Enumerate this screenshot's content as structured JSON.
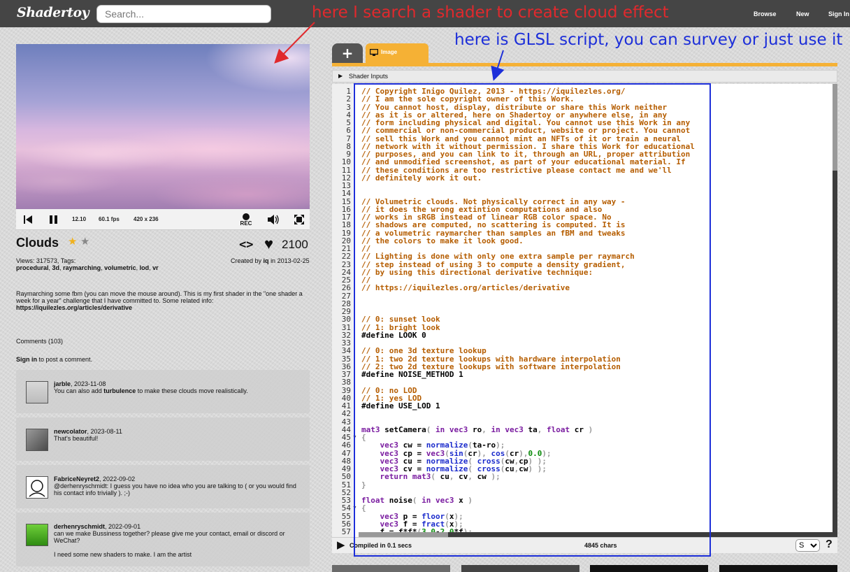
{
  "app": {
    "logo": "Shadertoy"
  },
  "search": {
    "placeholder": "Search..."
  },
  "nav": {
    "browse": "Browse",
    "new": "New",
    "signin": "Sign In"
  },
  "annotations": {
    "search_note": "here I search a shader to create cloud effect",
    "script_note": "here is GLSL script, you can survey or just use it"
  },
  "player": {
    "time": "12.10",
    "fps": "60.1 fps",
    "resolution": "420 x 236",
    "rec_label": "REC"
  },
  "shader": {
    "title": "Clouds",
    "likes": "2100",
    "views_line": "Views: 317573, Tags:",
    "tags": [
      "procedural",
      "3d",
      "raymarching",
      "volumetric",
      "lod",
      "vr"
    ],
    "created_by_prefix": "Created by",
    "author": "iq",
    "created_in": "in 2013-02-25",
    "description": "Raymarching some fbm (you can move the mouse around). This is my first shader in the \"one shader a week for a year\" challenge that I have committed to. Some related info:",
    "description_link": "https://iquilezles.org/articles/derivative"
  },
  "comments": {
    "header": "Comments (103)",
    "signin_link": "Sign in",
    "signin_rest": " to post a comment.",
    "items": [
      {
        "user": "jarble",
        "date": ", 2023-11-08",
        "text": "You can also add ",
        "bold": "turbulence",
        "text_after": " to make these clouds move realistically."
      },
      {
        "user": "newcolator",
        "date": ", 2023-08-11",
        "text": "That's beautiful!"
      },
      {
        "user": "FabriceNeyret2",
        "date": ", 2022-09-02",
        "text": "@derhenryschmidt: I guess you have no idea who you are talking to ( or you would find his contact info trivially ). ;-)"
      },
      {
        "user": "derhenryschmidt",
        "date": ", 2022-09-01",
        "text": "can we make Bussiness together? please give me your contact, email or discord or WeChat?",
        "text2": "I need some new shaders to make. I am the artist"
      }
    ]
  },
  "editor": {
    "tab_label": "Image",
    "add_tab": "+",
    "shader_inputs": "Shader Inputs",
    "status": "Compiled in 0.1 secs",
    "chars": "4845 chars",
    "font_select": "S",
    "help": "?",
    "lines": [
      [
        [
          "c",
          "// Copyright Inigo Quilez, 2013 - https://iquilezles.org/"
        ]
      ],
      [
        [
          "c",
          "// I am the sole copyright owner of this Work."
        ]
      ],
      [
        [
          "c",
          "// You cannot host, display, distribute or share this Work neither"
        ]
      ],
      [
        [
          "c",
          "// as it is or altered, here on Shadertoy or anywhere else, in any"
        ]
      ],
      [
        [
          "c",
          "// form including physical and digital. You cannot use this Work in any"
        ]
      ],
      [
        [
          "c",
          "// commercial or non-commercial product, website or project. You cannot"
        ]
      ],
      [
        [
          "c",
          "// sell this Work and you cannot mint an NFTs of it or train a neural"
        ]
      ],
      [
        [
          "c",
          "// network with it without permission. I share this Work for educational"
        ]
      ],
      [
        [
          "c",
          "// purposes, and you can link to it, through an URL, proper attribution"
        ]
      ],
      [
        [
          "c",
          "// and unmodified screenshot, as part of your educational material. If"
        ]
      ],
      [
        [
          "c",
          "// these conditions are too restrictive please contact me and we'll"
        ]
      ],
      [
        [
          "c",
          "// definitely work it out."
        ]
      ],
      [],
      [],
      [
        [
          "c",
          "// Volumetric clouds. Not physically correct in any way -"
        ]
      ],
      [
        [
          "c",
          "// it does the wrong extintion computations and also"
        ]
      ],
      [
        [
          "c",
          "// works in sRGB instead of linear RGB color space. No"
        ]
      ],
      [
        [
          "c",
          "// shadows are computed, no scattering is computed. It is"
        ]
      ],
      [
        [
          "c",
          "// a volumetric raymarcher than samples an fBM and tweaks"
        ]
      ],
      [
        [
          "c",
          "// the colors to make it look good."
        ]
      ],
      [
        [
          "c",
          "//"
        ]
      ],
      [
        [
          "c",
          "// Lighting is done with only one extra sample per raymarch"
        ]
      ],
      [
        [
          "c",
          "// step instead of using 3 to compute a density gradient,"
        ]
      ],
      [
        [
          "c",
          "// by using this directional derivative technique:"
        ]
      ],
      [
        [
          "c",
          "//"
        ]
      ],
      [
        [
          "c",
          "// https://iquilezles.org/articles/derivative"
        ]
      ],
      [],
      [],
      [],
      [
        [
          "c",
          "// 0: sunset look"
        ]
      ],
      [
        [
          "c",
          "// 1: bright look"
        ]
      ],
      [
        [
          "t",
          "#define LOOK 0"
        ]
      ],
      [],
      [
        [
          "c",
          "// 0: one 3d texture lookup"
        ]
      ],
      [
        [
          "c",
          "// 1: two 2d texture lookups with hardware interpolation"
        ]
      ],
      [
        [
          "c",
          "// 2: two 2d texture lookups with software interpolation"
        ]
      ],
      [
        [
          "t",
          "#define NOISE_METHOD 1"
        ]
      ],
      [],
      [
        [
          "c",
          "// 0: no LOD"
        ]
      ],
      [
        [
          "c",
          "// 1: yes LOD"
        ]
      ],
      [
        [
          "t",
          "#define USE_LOD 1"
        ]
      ],
      [],
      [],
      [
        [
          "k",
          "mat3"
        ],
        [
          "t",
          " setCamera"
        ],
        [
          "p",
          "( "
        ],
        [
          "k",
          "in vec3"
        ],
        [
          "t",
          " ro"
        ],
        [
          "p",
          ", "
        ],
        [
          "k",
          "in vec3"
        ],
        [
          "t",
          " ta"
        ],
        [
          "p",
          ", "
        ],
        [
          "k",
          "float"
        ],
        [
          "t",
          " cr "
        ],
        [
          "p",
          ")"
        ]
      ],
      [
        [
          "p",
          "{"
        ]
      ],
      [
        [
          "t",
          "    "
        ],
        [
          "k",
          "vec3"
        ],
        [
          "t",
          " cw = "
        ],
        [
          "f",
          "normalize"
        ],
        [
          "p",
          "("
        ],
        [
          "t",
          "ta-ro"
        ],
        [
          "p",
          ");"
        ]
      ],
      [
        [
          "t",
          "    "
        ],
        [
          "k",
          "vec3"
        ],
        [
          "t",
          " cp = "
        ],
        [
          "k",
          "vec3"
        ],
        [
          "p",
          "("
        ],
        [
          "f",
          "sin"
        ],
        [
          "p",
          "("
        ],
        [
          "t",
          "cr"
        ],
        [
          "p",
          "), "
        ],
        [
          "f",
          "cos"
        ],
        [
          "p",
          "("
        ],
        [
          "t",
          "cr"
        ],
        [
          "p",
          "),"
        ],
        [
          "n",
          "0.0"
        ],
        [
          "p",
          ");"
        ]
      ],
      [
        [
          "t",
          "    "
        ],
        [
          "k",
          "vec3"
        ],
        [
          "t",
          " cu = "
        ],
        [
          "f",
          "normalize"
        ],
        [
          "p",
          "( "
        ],
        [
          "f",
          "cross"
        ],
        [
          "p",
          "("
        ],
        [
          "t",
          "cw"
        ],
        [
          "p",
          ","
        ],
        [
          "t",
          "cp"
        ],
        [
          "p",
          ") );"
        ]
      ],
      [
        [
          "t",
          "    "
        ],
        [
          "k",
          "vec3"
        ],
        [
          "t",
          " cv = "
        ],
        [
          "f",
          "normalize"
        ],
        [
          "p",
          "( "
        ],
        [
          "f",
          "cross"
        ],
        [
          "p",
          "("
        ],
        [
          "t",
          "cu"
        ],
        [
          "p",
          ","
        ],
        [
          "t",
          "cw"
        ],
        [
          "p",
          ") );"
        ]
      ],
      [
        [
          "t",
          "    "
        ],
        [
          "k",
          "return"
        ],
        [
          "t",
          " "
        ],
        [
          "k",
          "mat3"
        ],
        [
          "p",
          "( "
        ],
        [
          "t",
          "cu"
        ],
        [
          "p",
          ", "
        ],
        [
          "t",
          "cv"
        ],
        [
          "p",
          ", "
        ],
        [
          "t",
          "cw "
        ],
        [
          "p",
          ");"
        ]
      ],
      [
        [
          "p",
          "}"
        ]
      ],
      [],
      [
        [
          "k",
          "float"
        ],
        [
          "t",
          " noise"
        ],
        [
          "p",
          "( "
        ],
        [
          "k",
          "in vec3"
        ],
        [
          "t",
          " x "
        ],
        [
          "p",
          ")"
        ]
      ],
      [
        [
          "p",
          "{"
        ]
      ],
      [
        [
          "t",
          "    "
        ],
        [
          "k",
          "vec3"
        ],
        [
          "t",
          " p = "
        ],
        [
          "f",
          "floor"
        ],
        [
          "p",
          "("
        ],
        [
          "t",
          "x"
        ],
        [
          "p",
          ");"
        ]
      ],
      [
        [
          "t",
          "    "
        ],
        [
          "k",
          "vec3"
        ],
        [
          "t",
          " f = "
        ],
        [
          "f",
          "fract"
        ],
        [
          "p",
          "("
        ],
        [
          "t",
          "x"
        ],
        [
          "p",
          ");"
        ]
      ],
      [
        [
          "t",
          "    f = f*f*"
        ],
        [
          "p",
          "("
        ],
        [
          "n",
          "3.0"
        ],
        [
          "t",
          "-"
        ],
        [
          "n",
          "2.0"
        ],
        [
          "t",
          "*f"
        ],
        [
          "p",
          ");"
        ]
      ]
    ]
  }
}
